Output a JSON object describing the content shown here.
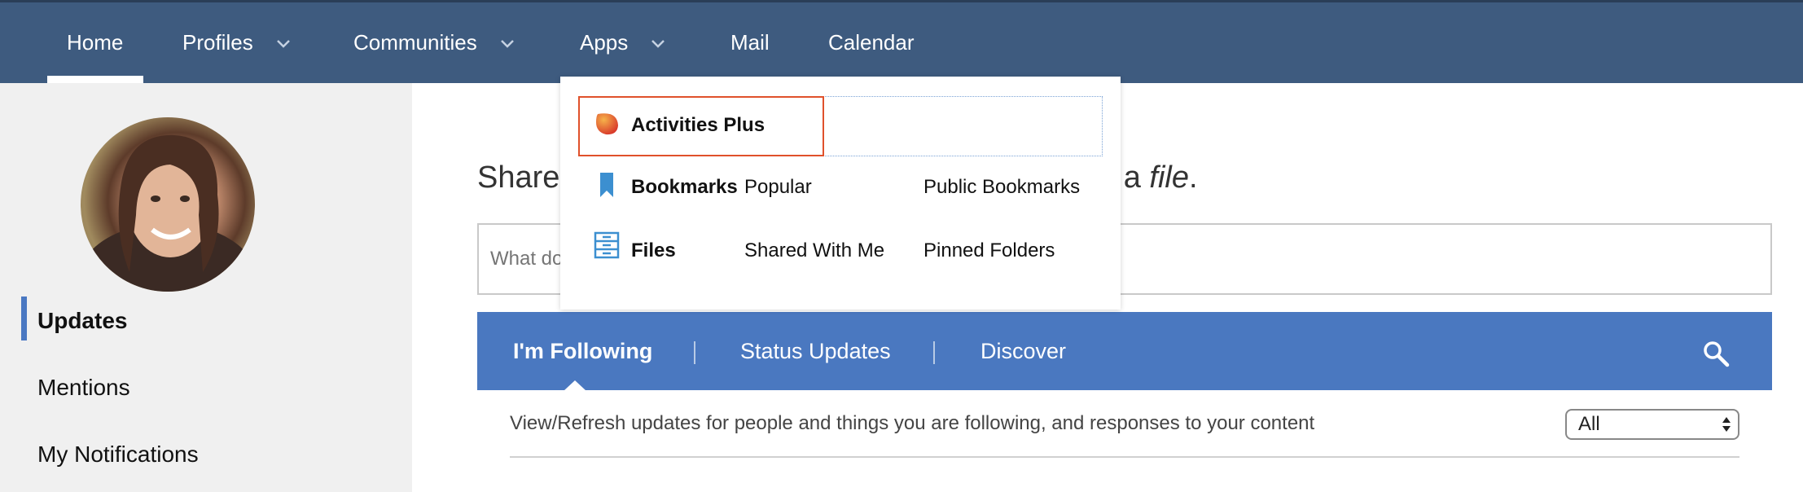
{
  "nav": {
    "items": [
      {
        "label": "Home"
      },
      {
        "label": "Profiles"
      },
      {
        "label": "Communities"
      },
      {
        "label": "Apps"
      },
      {
        "label": "Mail"
      },
      {
        "label": "Calendar"
      }
    ]
  },
  "sidebar": {
    "items": [
      {
        "label": "Updates",
        "active": true
      },
      {
        "label": "Mentions"
      },
      {
        "label": "My Notifications"
      }
    ]
  },
  "main": {
    "share_title_start": "Share",
    "share_title_mid": "d a ",
    "share_title_italic": "file",
    "share_title_end": ".",
    "status_placeholder": "What do",
    "tabs": [
      {
        "label": "I'm Following",
        "active": true
      },
      {
        "label": "Status Updates"
      },
      {
        "label": "Discover"
      }
    ],
    "filter_text": "View/Refresh updates for people and things you are following, and responses to your content",
    "filter_select_value": "All"
  },
  "apps_menu": {
    "rows": [
      {
        "app": "Activities Plus",
        "icon": "activities-plus-icon",
        "links": []
      },
      {
        "app": "Bookmarks",
        "icon": "bookmark-icon",
        "links": [
          "Popular",
          "Public Bookmarks"
        ]
      },
      {
        "app": "Files",
        "icon": "files-icon",
        "links": [
          "Shared With Me",
          "Pinned Folders"
        ]
      }
    ]
  },
  "colors": {
    "nav_bg": "#3e5b7f",
    "tabbar_bg": "#4a78c0",
    "highlight": "#e0512b",
    "sidebar_bg": "#f0f0f0"
  }
}
